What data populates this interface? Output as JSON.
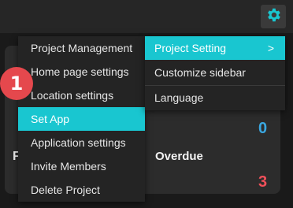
{
  "menu": {
    "items": [
      {
        "label": "Project Management"
      },
      {
        "label": "Home page settings"
      },
      {
        "label": "Location settings"
      },
      {
        "label": "Set App"
      },
      {
        "label": "Application settings"
      },
      {
        "label": "Invite Members"
      },
      {
        "label": "Delete Project"
      }
    ],
    "active_index": 3
  },
  "submenu": {
    "items": [
      {
        "label": "Project Setting",
        "chevron": ">"
      },
      {
        "label": "Customize sidebar"
      },
      {
        "label": "Language"
      }
    ]
  },
  "background": {
    "overdue_label": "Overdue",
    "overdue_count": "3",
    "progress_count": "0",
    "partial_letter": "F",
    "partial_label": "...p..."
  },
  "step_badge": "1",
  "icons": {
    "settings": "gear-icon"
  },
  "colors": {
    "accent": "#19c6d0",
    "badge": "#e5484d",
    "count_blue": "#3aa7e0",
    "count_red": "#f0505a"
  }
}
